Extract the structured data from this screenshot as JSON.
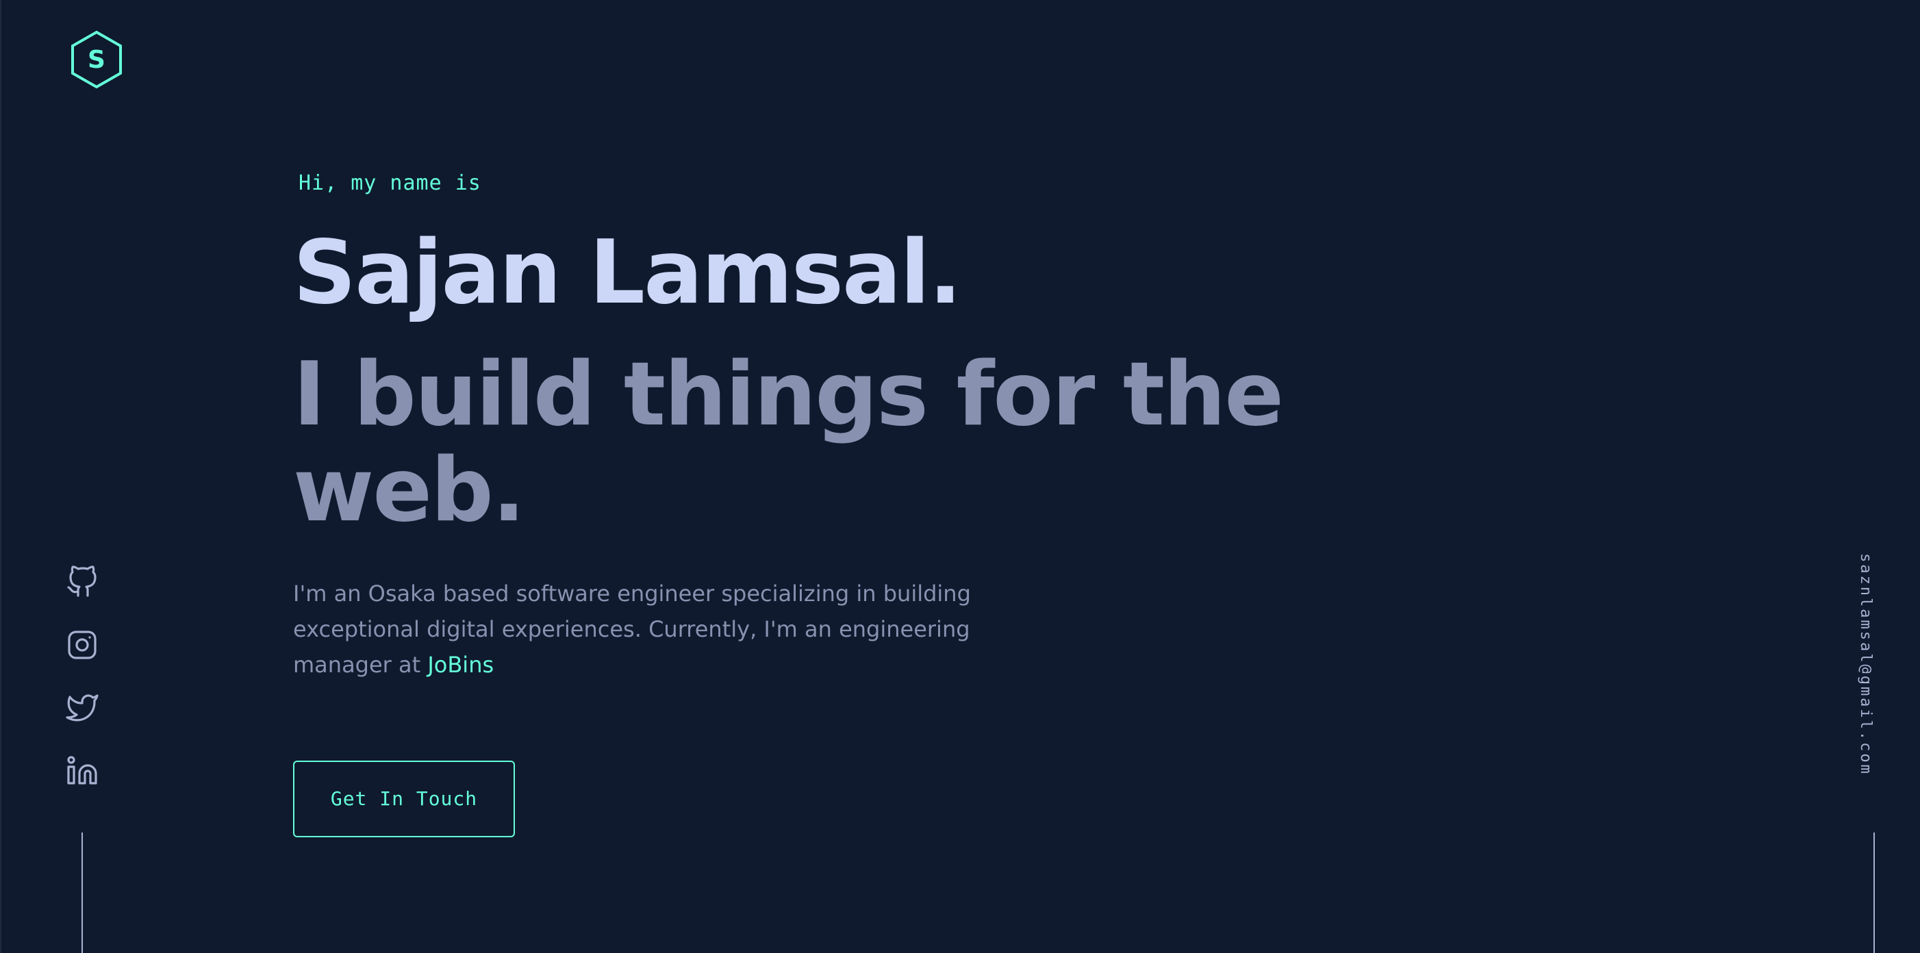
{
  "logo": {
    "letter": "S",
    "icon": "hexagon-logo-icon"
  },
  "social": {
    "items": [
      {
        "name": "GitHub",
        "icon": "github-icon"
      },
      {
        "name": "Instagram",
        "icon": "instagram-icon"
      },
      {
        "name": "Twitter",
        "icon": "twitter-icon"
      },
      {
        "name": "LinkedIn",
        "icon": "linkedin-icon"
      }
    ]
  },
  "email": "saznlamsal@gmail.com",
  "hero": {
    "greeting": "Hi, my name is",
    "name": "Sajan Lamsal.",
    "tagline": "I build things for the web.",
    "intro_prefix": "I'm an Osaka based software engineer specializing in building exceptional digital experiences. Currently, I'm an engineering manager at ",
    "company": "JoBins",
    "cta_label": "Get In Touch"
  },
  "colors": {
    "background": "#0f1a2e",
    "accent": "#64ffda",
    "heading": "#ccd6f6",
    "text": "#8892b0",
    "icon": "#a8b2d1"
  }
}
